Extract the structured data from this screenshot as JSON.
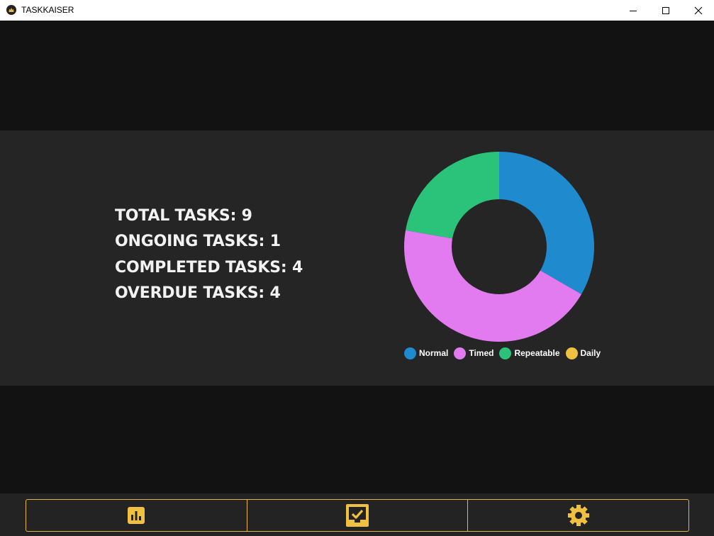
{
  "window": {
    "title": "TASKKAISER",
    "controls": [
      "minimize-icon",
      "maximize-icon",
      "close-icon"
    ]
  },
  "stats": {
    "total": "TOTAL TASKS: 9",
    "ongoing": "ONGOING TASKS: 1",
    "completed": "COMPLETED TASKS: 4",
    "overdue": "OVERDUE TASKS: 4"
  },
  "chart_data": {
    "type": "pie",
    "variant": "doughnut",
    "categories": [
      "Normal",
      "Timed",
      "Repeatable",
      "Daily"
    ],
    "values": [
      3,
      4,
      2,
      0
    ],
    "colors": [
      "#1f8ace",
      "#e27af0",
      "#2bc37a",
      "#f0c040"
    ],
    "legend": "bottom"
  },
  "nav": {
    "items": [
      {
        "name": "stats",
        "icon": "bar-chart-icon"
      },
      {
        "name": "tasks",
        "icon": "checkbox-icon"
      },
      {
        "name": "settings",
        "icon": "gear-icon"
      }
    ],
    "accent": "#f0c040"
  }
}
